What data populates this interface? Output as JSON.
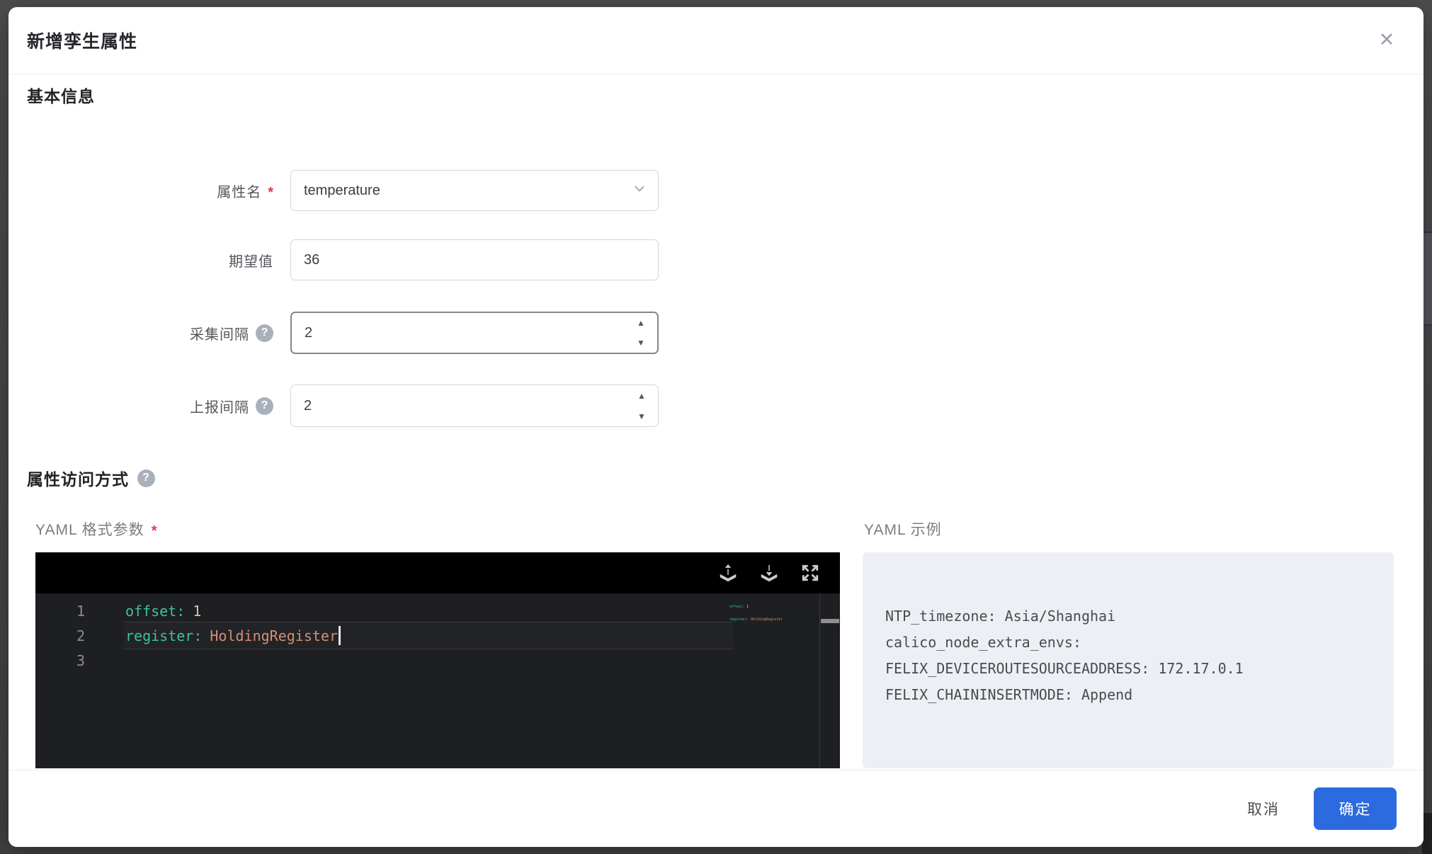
{
  "dialog": {
    "title": "新增孪生属性"
  },
  "icons": {
    "close": "✕",
    "help": "?",
    "step_up": "▲",
    "step_down": "▼"
  },
  "sections": {
    "basic_info": "基本信息",
    "access_mode": "属性访问方式"
  },
  "form": {
    "property_name": {
      "label": "属性名",
      "required_mark": "*",
      "value": "temperature"
    },
    "expected_value": {
      "label": "期望值",
      "value": "36"
    },
    "collect_interval": {
      "label": "采集间隔",
      "value": "2"
    },
    "report_interval": {
      "label": "上报间隔",
      "value": "2"
    }
  },
  "yaml_params": {
    "label": "YAML 格式参数",
    "required_mark": "*"
  },
  "yaml_editor": {
    "lines": [
      {
        "num": "1",
        "key": "offset:",
        "value": "1"
      },
      {
        "num": "2",
        "key": "register:",
        "value": "HoldingRegister"
      },
      {
        "num": "3",
        "key": "",
        "value": ""
      }
    ]
  },
  "yaml_example": {
    "label": "YAML 示例",
    "lines": [
      "NTP_timezone: Asia/Shanghai",
      "calico_node_extra_envs:",
      "FELIX_DEVICEROUTESOURCEADDRESS: 172.17.0.1",
      "FELIX_CHAININSERTMODE: Append"
    ]
  },
  "footer": {
    "cancel": "取消",
    "ok": "确定"
  },
  "colors": {
    "accent": "#2b6bdf",
    "required": "#e0394a",
    "editor_key": "#3fc0a0",
    "editor_number": "#c4cf9c",
    "editor_string": "#d18f72"
  }
}
